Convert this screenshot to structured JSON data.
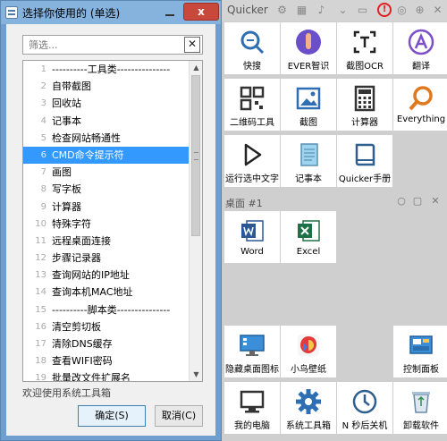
{
  "dialog": {
    "title": "选择你使用的 (单选)",
    "close_label": "x",
    "filter_placeholder": "筛选...",
    "clear_label": "✕",
    "items": [
      {
        "num": "1",
        "label": "----------工具类---------------"
      },
      {
        "num": "2",
        "label": "自带截图"
      },
      {
        "num": "3",
        "label": "回收站"
      },
      {
        "num": "4",
        "label": "记事本"
      },
      {
        "num": "5",
        "label": "检查网站畅通性"
      },
      {
        "num": "6",
        "label": "CMD命令提示符"
      },
      {
        "num": "7",
        "label": "画图"
      },
      {
        "num": "8",
        "label": "写字板"
      },
      {
        "num": "9",
        "label": "计算器"
      },
      {
        "num": "10",
        "label": "特殊字符"
      },
      {
        "num": "11",
        "label": "远程桌面连接"
      },
      {
        "num": "12",
        "label": "步骤记录器"
      },
      {
        "num": "13",
        "label": "查询网站的IP地址"
      },
      {
        "num": "14",
        "label": "查询本机MAC地址"
      },
      {
        "num": "15",
        "label": "----------脚本类---------------"
      },
      {
        "num": "16",
        "label": "清空剪切板"
      },
      {
        "num": "17",
        "label": "清除DNS缓存"
      },
      {
        "num": "18",
        "label": "查看WIFI密码"
      },
      {
        "num": "19",
        "label": "批量改文件扩展名"
      }
    ],
    "selected_index": 5,
    "welcome": "欢迎使用系统工具箱",
    "ok_label": "确定(S)",
    "cancel_label": "取消(C)"
  },
  "panel": {
    "title": "Quicker",
    "section_label": "桌面 #1",
    "tiles": [
      {
        "label": "快搜",
        "icon": "search-icon"
      },
      {
        "label": "EVER智识",
        "icon": "ever-icon"
      },
      {
        "label": "截图OCR",
        "icon": "ocr-icon"
      },
      {
        "label": "翻译",
        "icon": "translate-icon"
      },
      {
        "label": "二维码工具",
        "icon": "qrcode-icon"
      },
      {
        "label": "截图",
        "icon": "screenshot-icon"
      },
      {
        "label": "计算器",
        "icon": "calculator-icon"
      },
      {
        "label": "Everything",
        "icon": "everything-icon"
      },
      {
        "label": "运行选中文字",
        "icon": "play-icon"
      },
      {
        "label": "记事本",
        "icon": "notepad-icon"
      },
      {
        "label": "Quicker手册",
        "icon": "book-icon"
      },
      {
        "label": "Word",
        "icon": "word-icon"
      },
      {
        "label": "Excel",
        "icon": "excel-icon"
      },
      {
        "label": "隐藏桌面图标",
        "icon": "monitor-icon"
      },
      {
        "label": "小鸟壁纸",
        "icon": "bird-wallpaper-icon"
      },
      {
        "label": "控制面板",
        "icon": "control-panel-icon"
      },
      {
        "label": "我的电脑",
        "icon": "computer-icon"
      },
      {
        "label": "系统工具箱",
        "icon": "gear-icon"
      },
      {
        "label": "N 秒后关机",
        "icon": "clock-icon"
      },
      {
        "label": "卸载软件",
        "icon": "recycle-bin-icon"
      }
    ]
  }
}
